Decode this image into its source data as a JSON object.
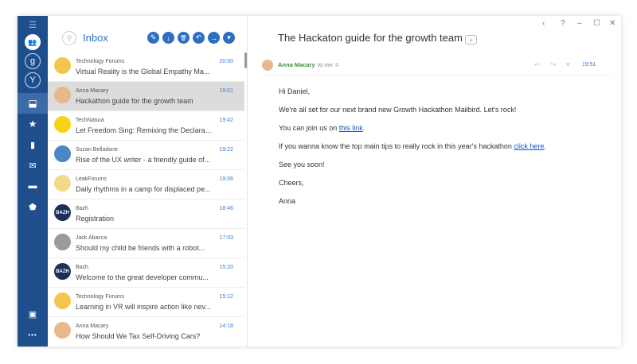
{
  "sidebar": {
    "items": [
      {
        "name": "menu-icon",
        "glyph": "☰"
      },
      {
        "name": "account-icon",
        "glyph": "👥"
      },
      {
        "name": "google-account-icon",
        "glyph": "g"
      },
      {
        "name": "yahoo-account-icon",
        "glyph": "Y"
      },
      {
        "name": "inbox-icon",
        "glyph": "⬓"
      },
      {
        "name": "star-icon",
        "glyph": "★"
      },
      {
        "name": "document-icon",
        "glyph": "▮"
      },
      {
        "name": "open-mail-icon",
        "glyph": "✉"
      },
      {
        "name": "archive-icon",
        "glyph": "▬"
      },
      {
        "name": "tag-icon",
        "glyph": "⬟"
      },
      {
        "name": "contacts-icon",
        "glyph": "▣"
      },
      {
        "name": "more-icon",
        "glyph": "•••"
      }
    ]
  },
  "list": {
    "title": "Inbox",
    "toolbar": [
      {
        "name": "compose-icon",
        "glyph": "✎"
      },
      {
        "name": "download-icon",
        "glyph": "↓"
      },
      {
        "name": "trash-icon",
        "glyph": "🗑"
      },
      {
        "name": "reply-icon",
        "glyph": "↶"
      },
      {
        "name": "forward-icon",
        "glyph": "→"
      },
      {
        "name": "dropdown-icon",
        "glyph": "▾"
      }
    ],
    "messages": [
      {
        "sender": "Technology Forums",
        "subject": "Virtual Reality is the Global Empathy Ma...",
        "time": "20:00",
        "avatar": "",
        "avatar_color": "#f3c64f"
      },
      {
        "sender": "Anna Macary",
        "subject": "Hackathon guide for the growth team",
        "time": "19:51",
        "avatar": "",
        "avatar_color": "#e9b88a"
      },
      {
        "sender": "TechNatura",
        "subject": "Let Freedom Sing: Remixing the Declarati...",
        "time": "19:42",
        "avatar": "",
        "avatar_color": "#f7d316"
      },
      {
        "sender": "Suzan Belladone",
        "subject": "Rise of the UX writer - a friendly guide of...",
        "time": "19:22",
        "avatar": "",
        "avatar_color": "#4b87c8"
      },
      {
        "sender": "LeakForums",
        "subject": "Daily rhythms in a camp for displaced pe...",
        "time": "19:06",
        "avatar": "",
        "avatar_color": "#f3d98a"
      },
      {
        "sender": "Bazh",
        "subject": "Registration",
        "time": "18:46",
        "avatar": "BAZH",
        "avatar_color": "#1b2f5a"
      },
      {
        "sender": "Jack Abacca",
        "subject": "Should my child be friends with a robot...",
        "time": "17:03",
        "avatar": "",
        "avatar_color": "#9a9a9a"
      },
      {
        "sender": "Bazh",
        "subject": "Welcome to the great developer commu...",
        "time": "15:20",
        "avatar": "BAZH",
        "avatar_color": "#1b2f5a"
      },
      {
        "sender": "Technology Forums",
        "subject": "Learning in VR will inspire action like nev...",
        "time": "15:12",
        "avatar": "",
        "avatar_color": "#f3c64f"
      },
      {
        "sender": "Anna Macary",
        "subject": "How Should We Tax Self-Driving Cars?",
        "time": "14:18",
        "avatar": "",
        "avatar_color": "#e9b88a"
      }
    ],
    "selected_index": 1
  },
  "window_controls": [
    "‹",
    "?",
    "–",
    "☐",
    "✕"
  ],
  "reader": {
    "title": "The Hackaton guide for the growth team",
    "from": "Anna Macary",
    "to": "to me ≑",
    "time": "19:51",
    "actions": [
      "↩",
      "↪",
      "▾"
    ],
    "greeting": "Hi Daniel,",
    "p1": "We're all set for our next brand new Growth Hackathon Mailbird. Let's rock!",
    "p2_prefix": "You can join us on ",
    "p2_link": "this link",
    "p2_suffix": ".",
    "p3_prefix": "If you wanna know the top main tips to really rock in this year's hackathon ",
    "p3_link": "click here",
    "p3_suffix": ".",
    "p4": "See you soon!",
    "p5": "Cheers,",
    "signature": "Anna"
  }
}
